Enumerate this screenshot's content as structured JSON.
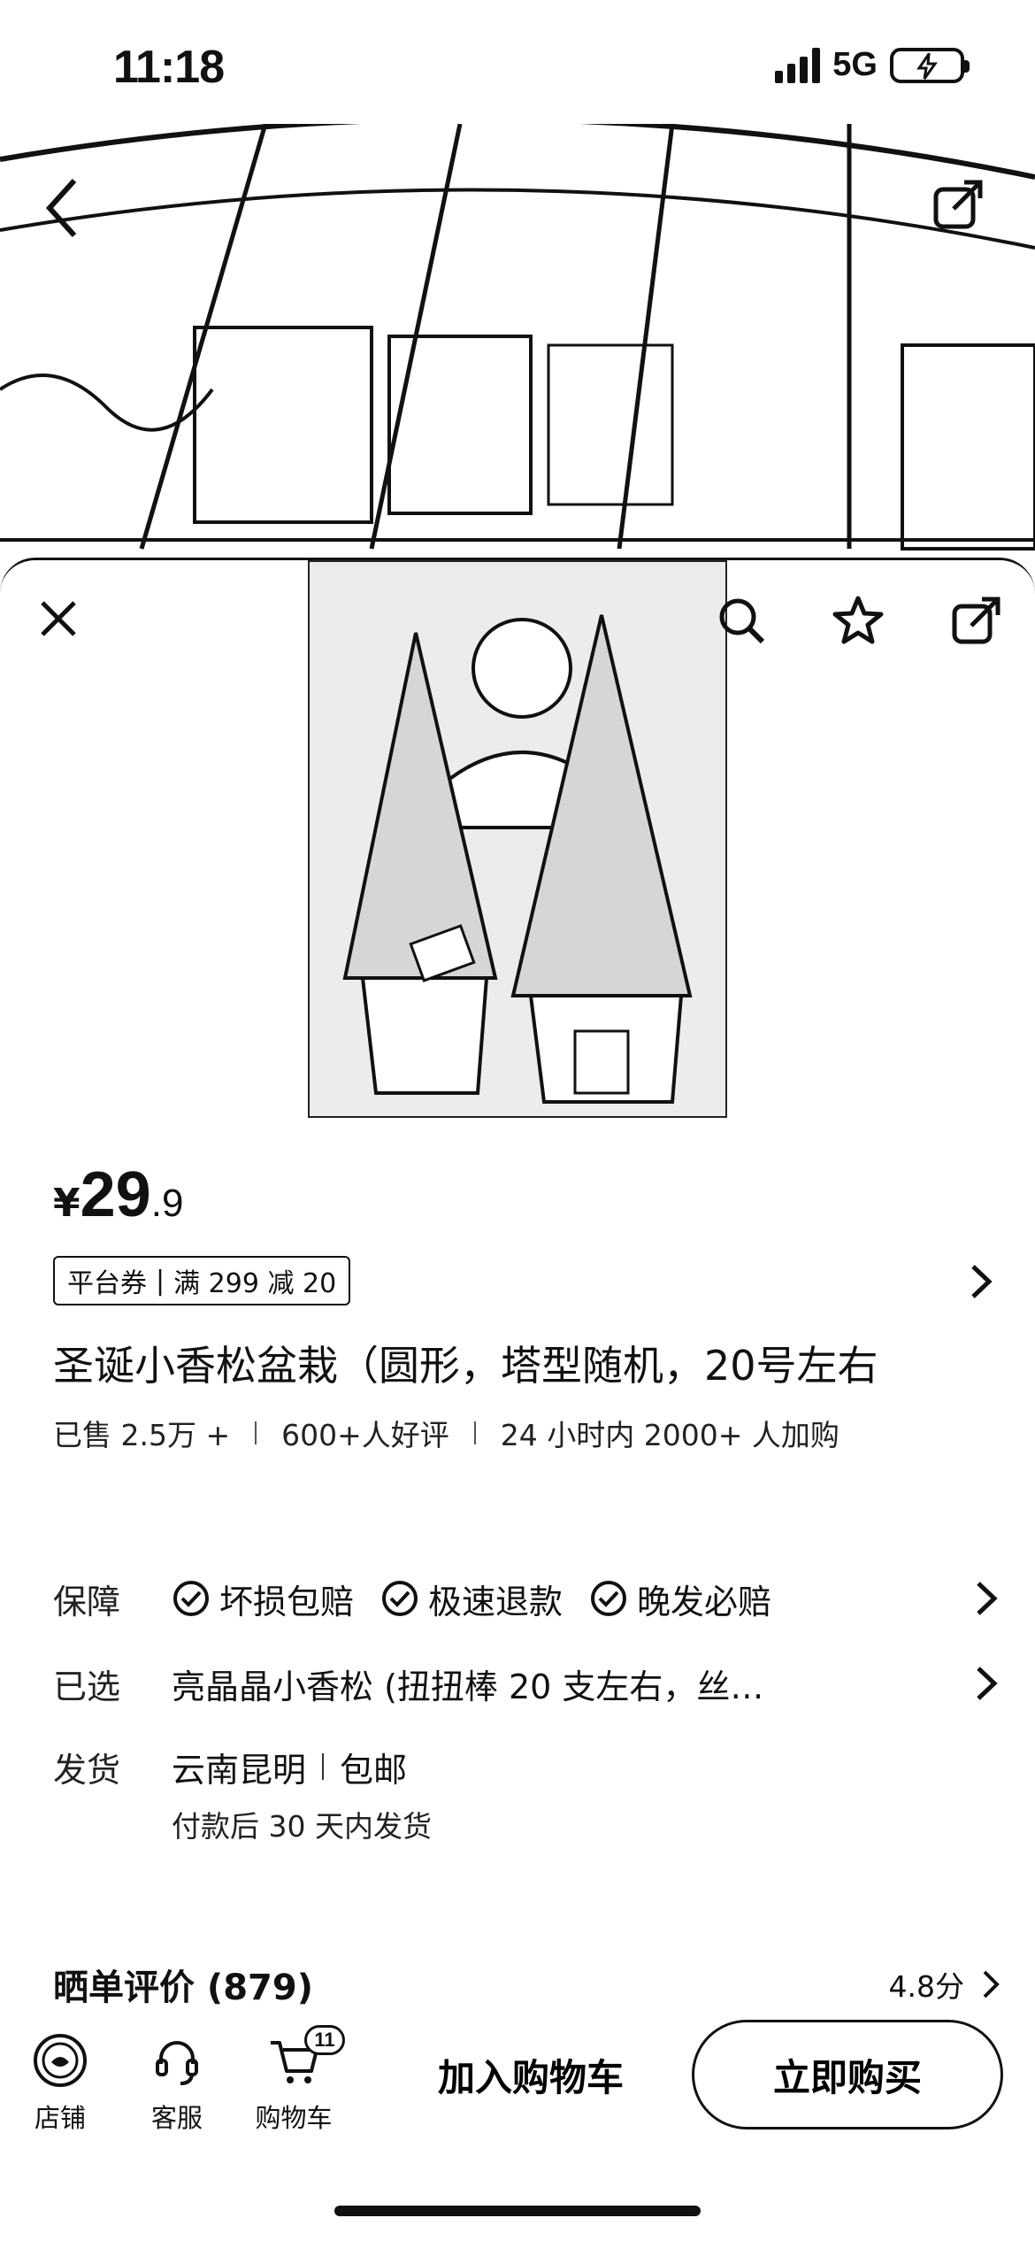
{
  "status_bar": {
    "time": "11:18",
    "network": "5G"
  },
  "header_actions": {
    "close_icon": "close-icon",
    "search_icon": "search-icon",
    "favorite_icon": "star-icon",
    "share_icon": "share-icon"
  },
  "product": {
    "price_currency": "¥",
    "price_integer": "29",
    "price_decimal": ".9",
    "coupon_tag": "平台券",
    "coupon_sep": "|",
    "coupon_detail": "满 299 减 20",
    "title": "圣诞小香松盆栽（圆形，塔型随机，20号左右",
    "stats": {
      "sold": "已售 2.5万 +",
      "good_reviews": "600+人好评",
      "cart_adds": "24 小时内 2000+ 人加购"
    }
  },
  "details": {
    "guarantee_label": "保障",
    "guarantees": [
      "坏损包赔",
      "极速退款",
      "晚发必赔"
    ],
    "selected_label": "已选",
    "selected_value": "亮晶晶小香松 (扭扭棒 20 支左右，丝…",
    "shipping_label": "发货",
    "shipping_origin": "云南昆明",
    "shipping_fee": "包邮",
    "shipping_note": "付款后 30 天内发货"
  },
  "reviews": {
    "title": "晒单评价 (879)",
    "score": "4.8分"
  },
  "bottom_bar": {
    "store_label": "店铺",
    "service_label": "客服",
    "cart_label": "购物车",
    "cart_badge": "11",
    "add_to_cart": "加入购物车",
    "buy_now": "立即购买"
  }
}
